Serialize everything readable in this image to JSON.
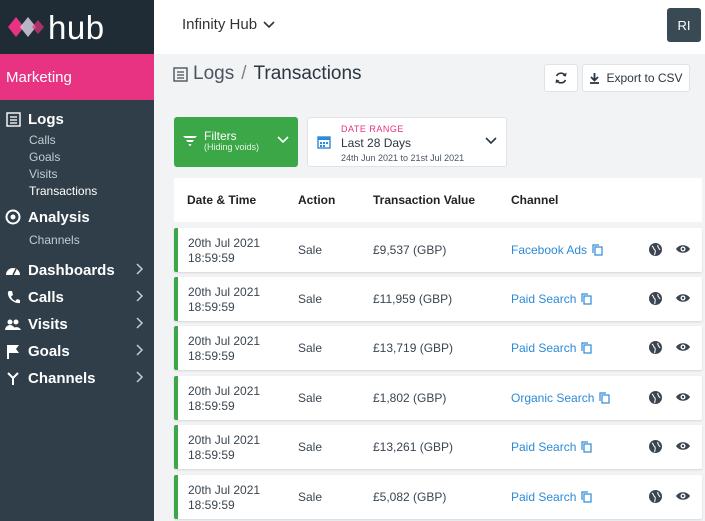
{
  "brand": {
    "logo_text": "hub",
    "section": "Marketing"
  },
  "sidebar": {
    "logs": {
      "label": "Logs",
      "items": [
        "Calls",
        "Goals",
        "Visits",
        "Transactions"
      ]
    },
    "analysis": {
      "label": "Analysis",
      "items": [
        "Channels"
      ]
    },
    "nav": [
      "Dashboards",
      "Calls",
      "Visits",
      "Goals",
      "Channels"
    ]
  },
  "header": {
    "workspace": "Infinity Hub",
    "avatar": "RI"
  },
  "page": {
    "crumb_parent": "Logs",
    "crumb_sep": "/",
    "title": "Transactions",
    "export_label": "Export to CSV"
  },
  "filters": {
    "label": "Filters",
    "sub": "(Hiding voids)"
  },
  "date_range": {
    "label": "DATE RANGE",
    "value": "Last 28 Days",
    "range": "24th Jun 2021 to 21st Jul 2021"
  },
  "table": {
    "headers": [
      "Date & Time",
      "Action",
      "Transaction Value",
      "Channel"
    ],
    "rows": [
      {
        "date": "20th Jul 2021",
        "time": "18:59:59",
        "action": "Sale",
        "value": "£9,537 (GBP)",
        "channel": "Facebook Ads"
      },
      {
        "date": "20th Jul 2021",
        "time": "18:59:59",
        "action": "Sale",
        "value": "£11,959 (GBP)",
        "channel": "Paid Search"
      },
      {
        "date": "20th Jul 2021",
        "time": "18:59:59",
        "action": "Sale",
        "value": "£13,719 (GBP)",
        "channel": "Paid Search"
      },
      {
        "date": "20th Jul 2021",
        "time": "18:59:59",
        "action": "Sale",
        "value": "£1,802 (GBP)",
        "channel": "Organic Search"
      },
      {
        "date": "20th Jul 2021",
        "time": "18:59:59",
        "action": "Sale",
        "value": "£13,261 (GBP)",
        "channel": "Paid Search"
      },
      {
        "date": "20th Jul 2021",
        "time": "18:59:59",
        "action": "Sale",
        "value": "£5,082 (GBP)",
        "channel": "Paid Search"
      }
    ]
  },
  "colors": {
    "accent": "#e73382",
    "green": "#3ba746",
    "link": "#2c8ad8",
    "sidebar": "#2f3e48"
  }
}
